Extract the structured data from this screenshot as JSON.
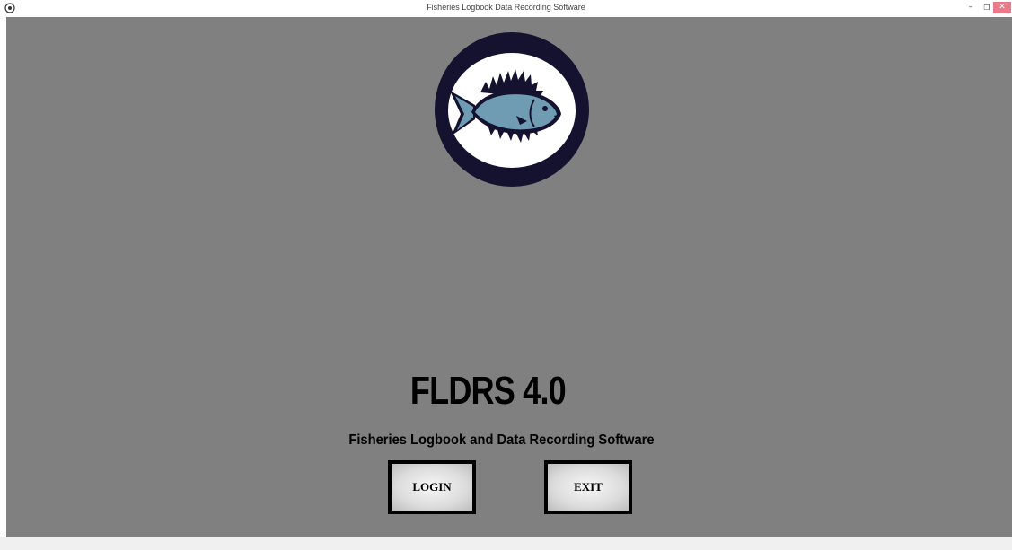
{
  "window": {
    "title": "Fisheries Logbook Data Recording Software",
    "minimize_glyph": "–",
    "maximize_glyph": "❐",
    "close_glyph": "✕"
  },
  "main": {
    "app_name": "FLDRS 4.0",
    "subtitle": "Fisheries Logbook and Data Recording Software",
    "login_label": "LOGIN",
    "exit_label": "EXIT"
  },
  "colors": {
    "background": "#808080",
    "logo_ring": "#14122e",
    "fish_body": "#6f9cb3",
    "close_button": "#e87a8a"
  },
  "icons": {
    "app": "app-icon",
    "logo": "fish-logo-icon"
  }
}
